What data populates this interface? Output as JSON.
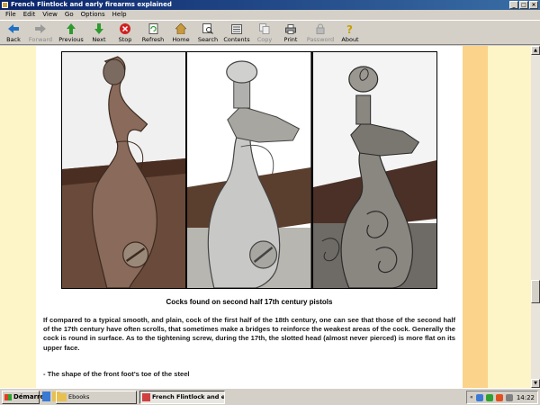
{
  "window": {
    "title": "French Flintlock and early firearms explained"
  },
  "menu": [
    "File",
    "Edit",
    "View",
    "Go",
    "Options",
    "Help"
  ],
  "toolbar": {
    "back": "Back",
    "forward": "Forward",
    "previous": "Previous",
    "next": "Next",
    "stop": "Stop",
    "refresh": "Refresh",
    "home": "Home",
    "search": "Search",
    "contents": "Contents",
    "copy": "Copy",
    "print": "Print",
    "password": "Password",
    "about": "About"
  },
  "article": {
    "caption": "Cocks found on second half 17th century pistols",
    "paragraph": "If compared to a typical smooth, and plain, cock of the first half of the 18th century, one can see that those of the second half of the 17th century have often scrolls, that sometimes make a bridges to reinforce the weakest areas of the cock. Generally the cock is round in surface. As to the tightening screw, during the 17th, the slotted head (almost never pierced) is more flat on its upper face.",
    "subheading": "- The shape of the front foot's toe of the steel"
  },
  "taskbar": {
    "start": "Démarrer",
    "tasks": [
      "Ebooks",
      "French Flintlock and e..."
    ],
    "clock": "14:22"
  },
  "colors": {
    "page_bg": "#fdf5c7",
    "band": "#fbd38b",
    "title_bar": "#0a246a"
  }
}
